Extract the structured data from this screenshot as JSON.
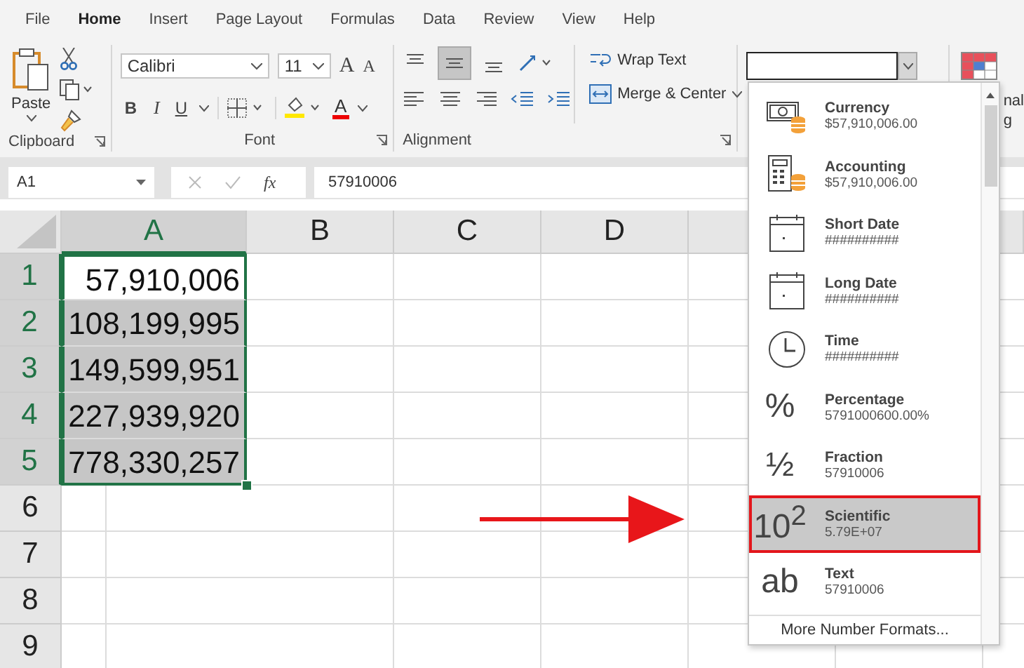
{
  "tabs": [
    {
      "label": "File",
      "selected": false
    },
    {
      "label": "Home",
      "selected": true
    },
    {
      "label": "Insert",
      "selected": false
    },
    {
      "label": "Page Layout",
      "selected": false
    },
    {
      "label": "Formulas",
      "selected": false
    },
    {
      "label": "Data",
      "selected": false
    },
    {
      "label": "Review",
      "selected": false
    },
    {
      "label": "View",
      "selected": false
    },
    {
      "label": "Help",
      "selected": false
    }
  ],
  "clipboard": {
    "paste": "Paste",
    "label": "Clipboard"
  },
  "font": {
    "name": "Calibri",
    "size": "11",
    "grow": "A",
    "shrink": "A",
    "bold": "B",
    "italic": "I",
    "underline": "U",
    "color_letter": "A",
    "label": "Font"
  },
  "alignment": {
    "vertical": [
      {
        "kind": "top",
        "selected": false
      },
      {
        "kind": "middle",
        "selected": true
      },
      {
        "kind": "bottom",
        "selected": false
      }
    ],
    "wrap": "Wrap Text",
    "merge": "Merge & Center",
    "label": "Alignment"
  },
  "styles": {
    "partial_lines": [
      "nal",
      "g"
    ]
  },
  "formula_bar": {
    "name_box": "A1",
    "fx": "fx",
    "formula": "57910006"
  },
  "sheet": {
    "columns": [
      {
        "label": "A",
        "selected": true
      },
      {
        "label": "B",
        "selected": false
      },
      {
        "label": "C",
        "selected": false
      },
      {
        "label": "D",
        "selected": false
      }
    ],
    "rows": [
      {
        "label": "1",
        "selected": true,
        "active": true,
        "value": "57,910,006"
      },
      {
        "label": "2",
        "selected": true,
        "active": false,
        "value": "108,199,995"
      },
      {
        "label": "3",
        "selected": true,
        "active": false,
        "value": "149,599,951"
      },
      {
        "label": "4",
        "selected": true,
        "active": false,
        "value": "227,939,920"
      },
      {
        "label": "5",
        "selected": true,
        "active": false,
        "value": "778,330,257"
      },
      {
        "label": "6",
        "selected": false
      },
      {
        "label": "7",
        "selected": false
      },
      {
        "label": "8",
        "selected": false
      },
      {
        "label": "9",
        "selected": false
      }
    ]
  },
  "number_format_menu": {
    "items": [
      {
        "kind": "currency",
        "name": "Currency",
        "sample": "$57,910,006.00",
        "selected": false
      },
      {
        "kind": "accounting",
        "name": "Accounting",
        "sample": "$57,910,006.00",
        "selected": false
      },
      {
        "kind": "date",
        "name": "Short Date",
        "sample": "##########",
        "selected": false
      },
      {
        "kind": "date",
        "name": "Long Date",
        "sample": "##########",
        "selected": false
      },
      {
        "kind": "time",
        "name": "Time",
        "sample": "##########",
        "selected": false
      },
      {
        "kind": "glyph",
        "glyph": "%",
        "name": "Percentage",
        "sample": "5791000600.00%",
        "selected": false
      },
      {
        "kind": "glyph",
        "glyph": "½",
        "name": "Fraction",
        "sample": "57910006",
        "selected": false
      },
      {
        "kind": "glyph",
        "glyph": "10$^{2}$",
        "name": "Scientific",
        "sample": "5.79E+07",
        "selected": true
      },
      {
        "kind": "glyph",
        "glyph": "ab",
        "name": "Text",
        "sample": "57910006",
        "selected": false
      }
    ],
    "more": "More Number Formats..."
  }
}
